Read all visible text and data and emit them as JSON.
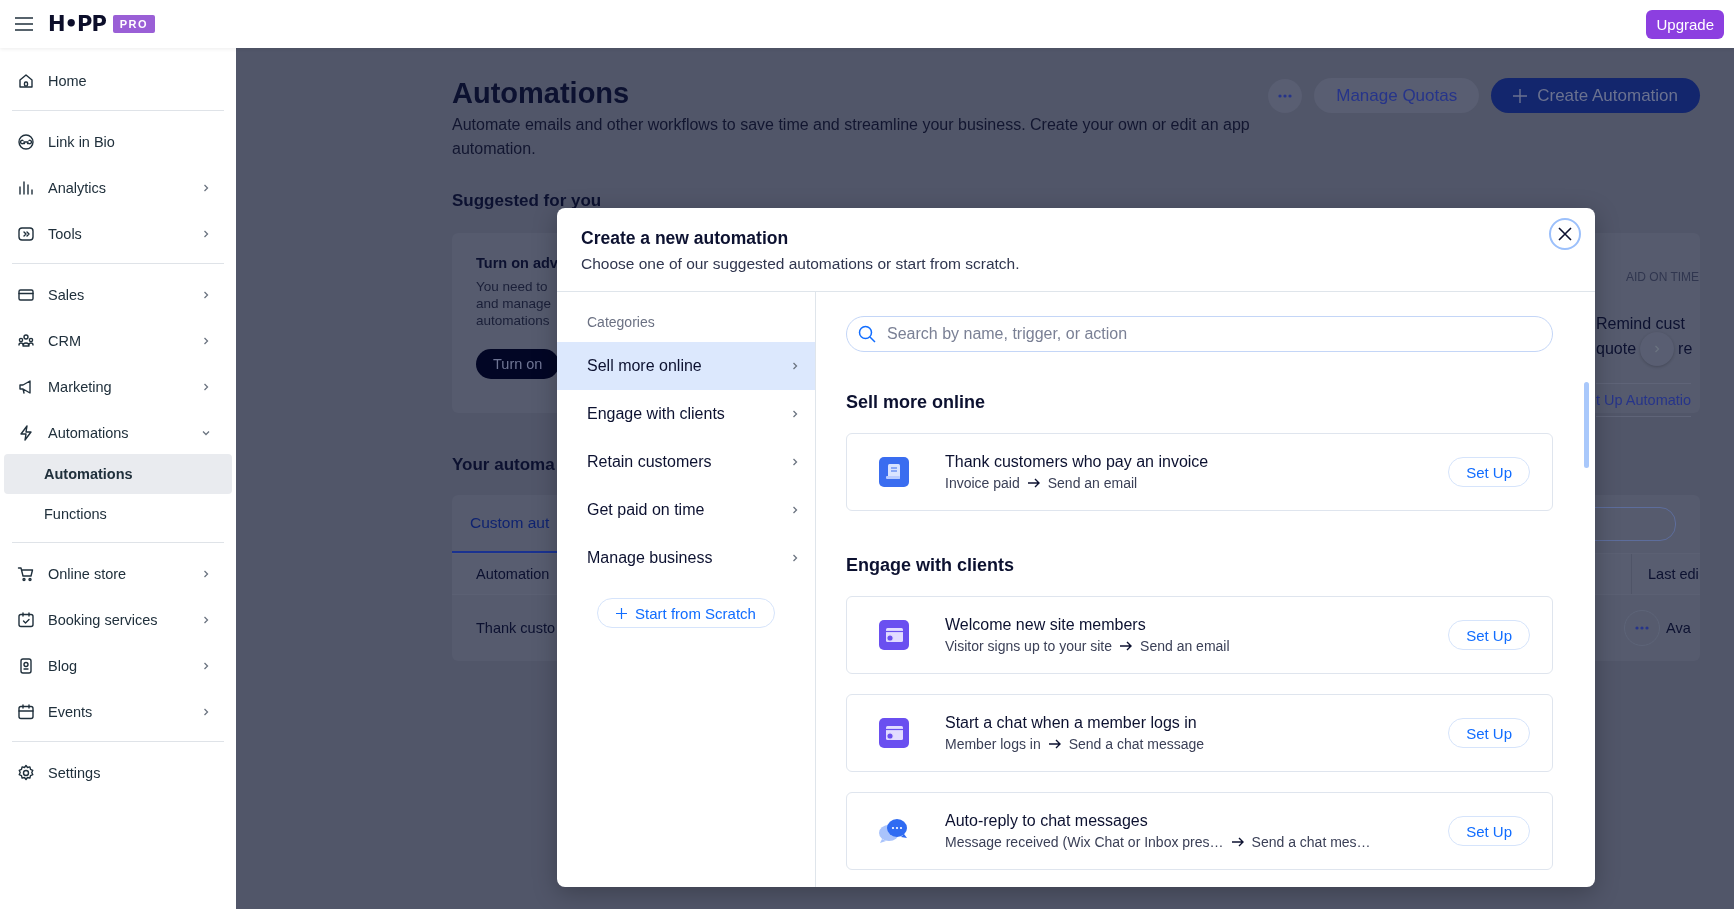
{
  "topbar": {
    "logo": "H•PP",
    "badge": "PRO",
    "upgrade": "Upgrade"
  },
  "sidebar": {
    "groups": [
      [
        {
          "label": "Home"
        }
      ],
      [
        {
          "label": "Link in Bio"
        },
        {
          "label": "Analytics",
          "expanded": false
        },
        {
          "label": "Tools",
          "expanded": false
        }
      ],
      [
        {
          "label": "Sales",
          "expanded": false
        },
        {
          "label": "CRM",
          "expanded": false
        },
        {
          "label": "Marketing",
          "expanded": false
        },
        {
          "label": "Automations",
          "expanded": true,
          "children": [
            {
              "label": "Automations",
              "selected": true
            },
            {
              "label": "Functions",
              "selected": false
            }
          ]
        }
      ],
      [
        {
          "label": "Online store",
          "expanded": false
        },
        {
          "label": "Booking services",
          "expanded": false
        },
        {
          "label": "Blog",
          "expanded": false
        },
        {
          "label": "Events",
          "expanded": false
        }
      ],
      [
        {
          "label": "Settings"
        }
      ]
    ]
  },
  "page": {
    "title": "Automations",
    "description": "Automate emails and other workflows to save time and streamline your business. Create your own or edit an app automation.",
    "buttons": [
      "Manage Quotas",
      "Create Automation"
    ],
    "suggested_heading": "Suggested for you",
    "suggested_left": {
      "title": "Turn on adv",
      "body": [
        "You need to",
        "and manage",
        "automations"
      ],
      "button": "Turn on"
    },
    "suggested_right": {
      "category": "AID ON TIME",
      "title": "Remind cust",
      "title_line2": "quote",
      "title_tail": "re",
      "link": "t Up Automatio"
    },
    "your_heading": "Your automa",
    "table": {
      "tab": "Custom aut",
      "columns": [
        "Automation",
        "Last edi"
      ],
      "row": [
        "Thank custo",
        "Ava"
      ]
    }
  },
  "modal": {
    "title": "Create a new automation",
    "subtitle": "Choose one of our suggested automations or start from scratch.",
    "categories_label": "Categories",
    "categories": [
      {
        "label": "Sell more online",
        "selected": true
      },
      {
        "label": "Engage with clients",
        "selected": false
      },
      {
        "label": "Retain customers",
        "selected": false
      },
      {
        "label": "Get paid on time",
        "selected": false
      },
      {
        "label": "Manage business",
        "selected": false
      }
    ],
    "scratch_button": "Start from Scratch",
    "search": {
      "placeholder": "Search by name, trigger, or action"
    },
    "sections": [
      {
        "heading": "Sell more online",
        "items": [
          {
            "title": "Thank customers who pay an invoice",
            "trigger": "Invoice paid",
            "action": "Send an email",
            "button": "Set Up"
          }
        ]
      },
      {
        "heading": "Engage with clients",
        "items": [
          {
            "title": "Welcome new site members",
            "trigger": "Visitor signs up to your site",
            "action": "Send an email",
            "button": "Set Up"
          },
          {
            "title": "Start a chat when a member logs in",
            "trigger": "Member logs in",
            "action": "Send a chat message",
            "button": "Set Up"
          },
          {
            "title": "Auto-reply to chat messages",
            "trigger": "Message received (Wix Chat or Inbox pres…",
            "action": "Send a chat mes…",
            "button": "Set Up"
          }
        ]
      }
    ]
  }
}
